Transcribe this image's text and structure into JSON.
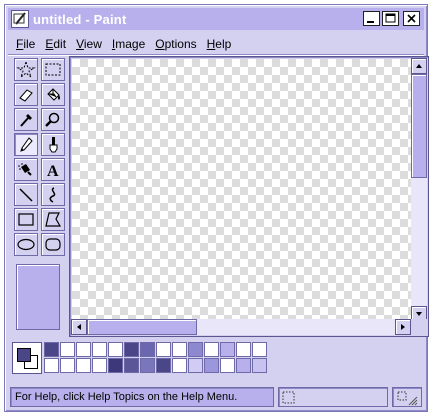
{
  "window": {
    "title": "untitled - Paint"
  },
  "menu": {
    "items": [
      {
        "label": "File",
        "mnemonic": "F",
        "rest": "ile"
      },
      {
        "label": "Edit",
        "mnemonic": "E",
        "rest": "dit"
      },
      {
        "label": "View",
        "mnemonic": "V",
        "rest": "iew"
      },
      {
        "label": "Image",
        "mnemonic": "I",
        "rest": "mage"
      },
      {
        "label": "Options",
        "mnemonic": "O",
        "rest": "ptions"
      },
      {
        "label": "Help",
        "mnemonic": "H",
        "rest": "elp"
      }
    ]
  },
  "tools": [
    {
      "name": "free-form-select",
      "icon": "star-select-icon"
    },
    {
      "name": "rect-select",
      "icon": "rect-select-icon"
    },
    {
      "name": "eraser",
      "icon": "eraser-icon"
    },
    {
      "name": "fill",
      "icon": "fill-bucket-icon"
    },
    {
      "name": "pick-color",
      "icon": "eyedropper-icon"
    },
    {
      "name": "magnifier",
      "icon": "magnifier-icon"
    },
    {
      "name": "pencil",
      "icon": "pencil-icon",
      "selected": true
    },
    {
      "name": "brush",
      "icon": "brush-icon"
    },
    {
      "name": "airbrush",
      "icon": "airbrush-icon"
    },
    {
      "name": "text",
      "icon": "text-icon",
      "glyph": "A"
    },
    {
      "name": "line",
      "icon": "line-icon"
    },
    {
      "name": "curve",
      "icon": "curve-icon"
    },
    {
      "name": "rectangle",
      "icon": "rectangle-icon"
    },
    {
      "name": "polygon",
      "icon": "polygon-icon"
    },
    {
      "name": "ellipse",
      "icon": "ellipse-icon"
    },
    {
      "name": "rounded-rectangle",
      "icon": "rounded-rect-icon"
    }
  ],
  "colors": {
    "foreground": "#4a4688",
    "background": "#ffffff",
    "palette_row1": [
      "#4a4688",
      "#ffffff",
      "#ffffff",
      "#ffffff",
      "#ffffff",
      "#4a4688",
      "#6a66b0",
      "#ffffff",
      "#ffffff",
      "#8e88d0",
      "#ffffff",
      "#b8b0ec",
      "#ffffff",
      "#ffffff"
    ],
    "palette_row2": [
      "#ffffff",
      "#ffffff",
      "#ffffff",
      "#ffffff",
      "#3c387a",
      "#5a5698",
      "#7a76bc",
      "#4a4688",
      "#ffffff",
      "#d0ccf4",
      "#9c96dc",
      "#ffffff",
      "#b8b0ec",
      "#c8c2f0"
    ]
  },
  "statusbar": {
    "help_text": "For Help, click Help Topics on the Help Menu."
  }
}
